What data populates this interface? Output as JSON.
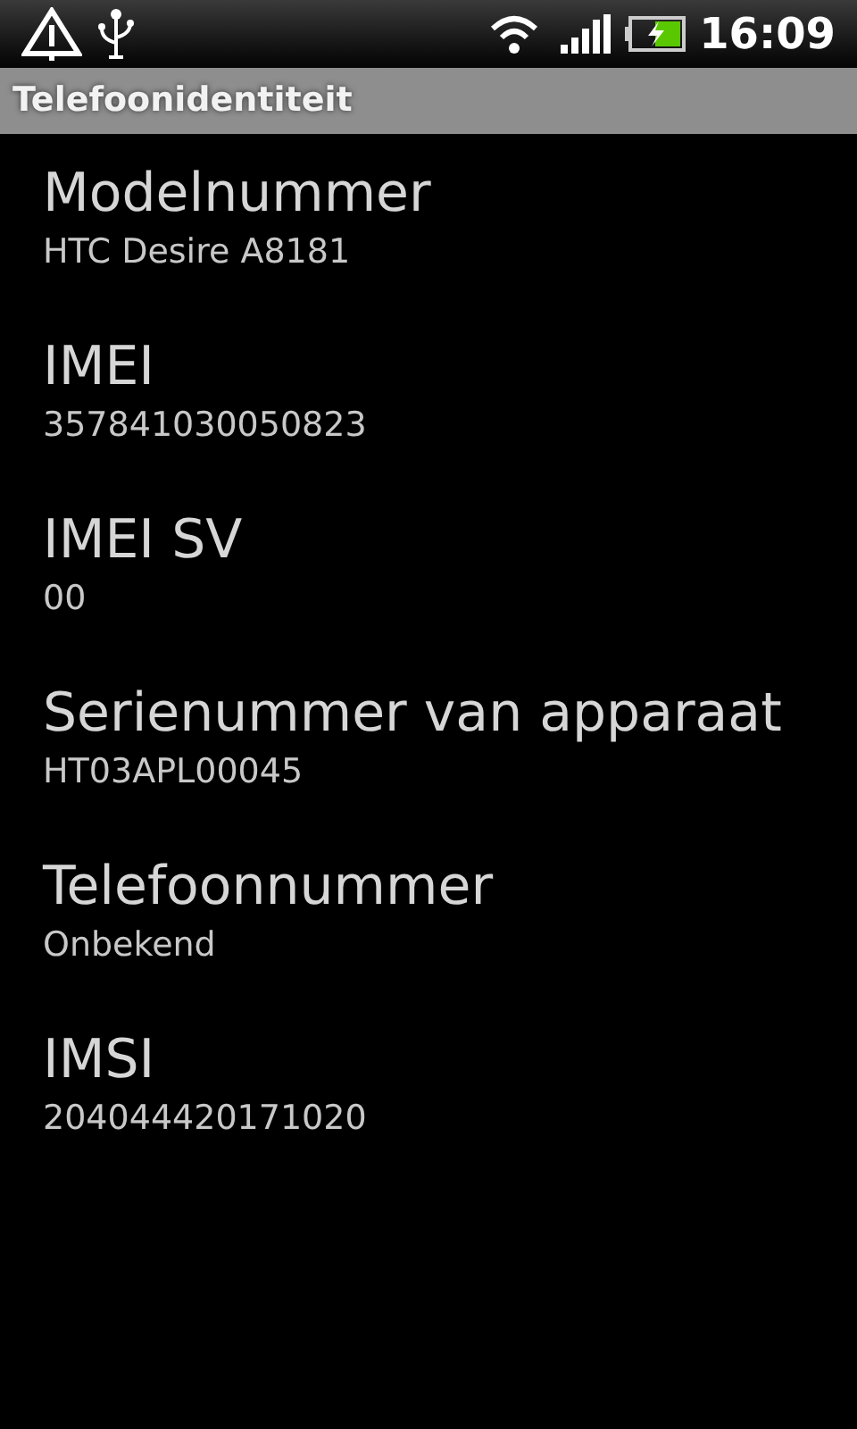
{
  "status_bar": {
    "time": "16:09"
  },
  "title": "Telefoonidentiteit",
  "items": [
    {
      "label": "Modelnummer",
      "value": "HTC Desire A8181"
    },
    {
      "label": "IMEI",
      "value": "357841030050823"
    },
    {
      "label": "IMEI SV",
      "value": "00"
    },
    {
      "label": "Serienummer van apparaat",
      "value": "HT03APL00045"
    },
    {
      "label": "Telefoonnummer",
      "value": "Onbekend"
    },
    {
      "label": "IMSI",
      "value": "204044420171020"
    }
  ]
}
